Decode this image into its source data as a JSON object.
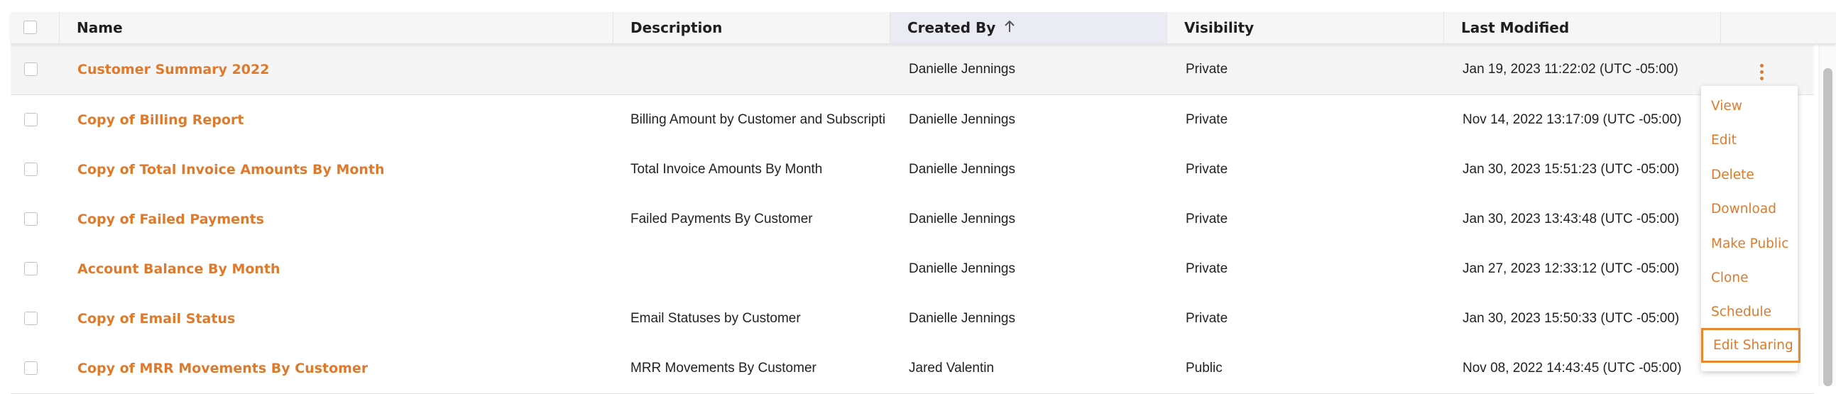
{
  "columns": {
    "name": "Name",
    "description": "Description",
    "created_by": "Created By",
    "visibility": "Visibility",
    "last_modified": "Last Modified"
  },
  "sort_icon": "arrow-up-icon",
  "rows": [
    {
      "name": "Customer Summary 2022",
      "description": "",
      "created_by": "Danielle Jennings",
      "visibility": "Private",
      "last_modified": "Jan 19, 2023 11:22:02 (UTC -05:00)"
    },
    {
      "name": "Copy of Billing Report",
      "description": "Billing Amount by Customer and Subscripti",
      "created_by": "Danielle Jennings",
      "visibility": "Private",
      "last_modified": "Nov 14, 2022 13:17:09 (UTC -05:00)"
    },
    {
      "name": "Copy of Total Invoice Amounts By Month",
      "description": "Total Invoice Amounts By Month",
      "created_by": "Danielle Jennings",
      "visibility": "Private",
      "last_modified": "Jan 30, 2023 15:51:23 (UTC -05:00)"
    },
    {
      "name": "Copy of Failed Payments",
      "description": "Failed Payments By Customer",
      "created_by": "Danielle Jennings",
      "visibility": "Private",
      "last_modified": "Jan 30, 2023 13:43:48 (UTC -05:00)"
    },
    {
      "name": "Account Balance By Month",
      "description": "",
      "created_by": "Danielle Jennings",
      "visibility": "Private",
      "last_modified": "Jan 27, 2023 12:33:12 (UTC -05:00)"
    },
    {
      "name": "Copy of Email Status",
      "description": "Email Statuses by Customer",
      "created_by": "Danielle Jennings",
      "visibility": "Private",
      "last_modified": "Jan 30, 2023 15:50:33 (UTC -05:00)"
    },
    {
      "name": "Copy of MRR Movements By Customer",
      "description": "MRR Movements By Customer",
      "created_by": "Jared Valentin",
      "visibility": "Public",
      "last_modified": "Nov 08, 2022 14:43:45 (UTC -05:00)"
    }
  ],
  "menu": {
    "items": [
      "View",
      "Edit",
      "Delete",
      "Download",
      "Make Public",
      "Clone",
      "Schedule",
      "Edit Sharing"
    ]
  },
  "colors": {
    "accent": "#df7a2d",
    "highlight_border": "#e8892f"
  }
}
